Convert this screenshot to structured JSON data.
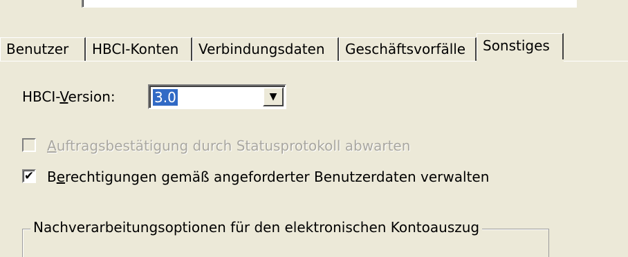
{
  "tabs": [
    {
      "label": "Benutzer",
      "selected": false
    },
    {
      "label": "HBCI-Konten",
      "selected": false
    },
    {
      "label": "Verbindungsdaten",
      "selected": false
    },
    {
      "label": "Geschäftsvorfälle",
      "selected": false
    },
    {
      "label": "Sonstiges",
      "selected": true
    }
  ],
  "version": {
    "label_pre": "HBCI-",
    "label_accel": "V",
    "label_post": "ersion:",
    "selected": "3.0",
    "dropdown_icon": "chevron-down-icon"
  },
  "checkboxes": {
    "status_protocol": {
      "accel": "A",
      "label_rest": "uftragsbestätigung durch Statusprotokoll abwarten",
      "checked": false,
      "enabled": false
    },
    "permissions": {
      "accel_pre": "B",
      "accel": "e",
      "label_rest": "rechtigungen gemäß angeforderter Benutzerdaten verwalten",
      "checked": true,
      "enabled": true
    }
  },
  "group": {
    "title": "Nachverarbeitungsoptionen für den elektronischen Kontoauszug"
  },
  "check_glyph": "✔"
}
